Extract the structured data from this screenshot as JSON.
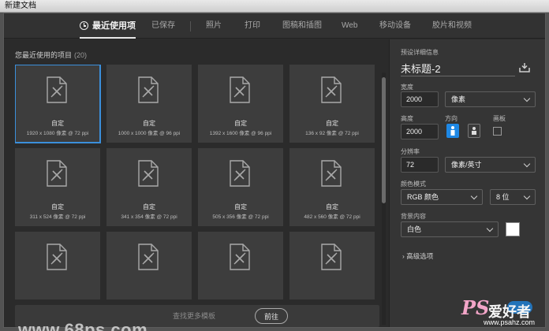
{
  "window": {
    "title": "新建文档"
  },
  "tabs": [
    {
      "label": "最近使用项",
      "active": true,
      "icon": "clock-icon"
    },
    {
      "label": "已保存"
    },
    {
      "label": "照片"
    },
    {
      "label": "打印"
    },
    {
      "label": "图稿和插图"
    },
    {
      "label": "Web"
    },
    {
      "label": "移动设备"
    },
    {
      "label": "胶片和视频"
    }
  ],
  "recent": {
    "title": "您最近使用的项目",
    "count": "(20)",
    "items": [
      {
        "name": "自定",
        "size": "1920 x 1080 像素 @ 72 ppi",
        "selected": true
      },
      {
        "name": "自定",
        "size": "1000 x 1000 像素 @ 96 ppi"
      },
      {
        "name": "自定",
        "size": "1392 x 1600 像素 @ 96 ppi"
      },
      {
        "name": "自定",
        "size": "136 x 92 像素 @ 72 ppi"
      },
      {
        "name": "自定",
        "size": "311 x 524 像素 @ 72 ppi"
      },
      {
        "name": "自定",
        "size": "341 x 354 像素 @ 72 ppi"
      },
      {
        "name": "自定",
        "size": "505 x 356 像素 @ 72 ppi"
      },
      {
        "name": "自定",
        "size": "482 x 560 像素 @ 72 ppi"
      },
      {
        "name": "",
        "size": ""
      },
      {
        "name": "",
        "size": ""
      },
      {
        "name": "",
        "size": ""
      },
      {
        "name": "",
        "size": ""
      }
    ],
    "card_icon": "document-icon"
  },
  "search": {
    "placeholder": "查找更多模板",
    "go_label": "前往"
  },
  "watermark": {
    "site": "www.68ps.com",
    "logo_ps": "PS",
    "logo_cn": "爱好者",
    "logo_url": "www.psahz.com"
  },
  "preset": {
    "section_label": "预设详细信息",
    "doc_title": "未标题-2",
    "save_icon": "save-preset-icon",
    "width_label": "宽度",
    "width_value": "2000",
    "width_unit": "像素",
    "height_label": "高度",
    "height_value": "2000",
    "orientation_label": "方向",
    "artboard_label": "画板",
    "resolution_label": "分辨率",
    "resolution_value": "72",
    "resolution_unit": "像素/英寸",
    "colormode_label": "颜色模式",
    "colormode_value": "RGB 颜色",
    "bitdepth_value": "8 位",
    "background_label": "背景内容",
    "background_value": "白色",
    "background_color": "#ffffff",
    "advanced_label": "高级选项"
  },
  "colors": {
    "accent": "#1e88e5",
    "selection": "#3b8fdb",
    "panel": "#353535",
    "card": "#3d3d3d"
  }
}
